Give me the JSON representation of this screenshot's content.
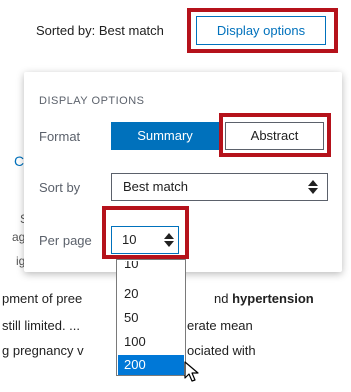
{
  "header": {
    "sorted_by_text": "Sorted by: Best match",
    "display_button_label": "Display options"
  },
  "background": {
    "partial_c": "C",
    "partial_s": "S",
    "partial_ag": "ag",
    "partial_ig": "ig",
    "snippet_1_prefix": "pment of pree",
    "snippet_1_mid": "nd ",
    "snippet_1_bold": "hypertension",
    "snippet_2_prefix": "still limited. ...",
    "snippet_2_suffix": "erate mean",
    "snippet_3_prefix": "g pregnancy v",
    "snippet_3_suffix": "ociated with"
  },
  "panel": {
    "title": "DISPLAY OPTIONS",
    "format_label": "Format",
    "format_options": [
      "Summary",
      "Abstract"
    ],
    "format_selected": "Summary",
    "sort_label": "Sort by",
    "sort_value": "Best match",
    "perpage_label": "Per page",
    "perpage_value": "10"
  },
  "dropdown": {
    "options": [
      "10",
      "20",
      "50",
      "100",
      "200"
    ],
    "highlighted": "200"
  },
  "colors": {
    "accent": "#0071bc",
    "highlight_box": "#b5121b",
    "selected_option": "#0078d7"
  },
  "icons": {
    "select_arrows": "updown-icon",
    "pointer": "cursor-icon"
  }
}
